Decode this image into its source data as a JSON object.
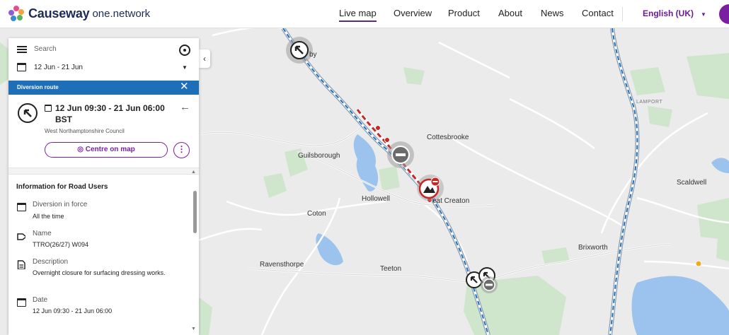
{
  "header": {
    "brand": "Causeway",
    "brand_sub": "one.network",
    "nav": [
      "Live map",
      "Overview",
      "Product",
      "About",
      "News",
      "Contact"
    ],
    "active_nav": "Live map",
    "language": "English (UK)"
  },
  "panel": {
    "search_placeholder": "Search",
    "date_range": "12 Jun - 21 Jun",
    "diversion_title": "Diversion route",
    "timeframe": "12 Jun 09:30 - 21 Jun 06:00 BST",
    "council": "West Northamptonshire Council",
    "centre_button": "Centre on map",
    "info_heading": "Information for Road Users",
    "rows": [
      {
        "label": "Diversion in force",
        "value": "All the time",
        "icon": "calendar-sync-icon"
      },
      {
        "label": "Name",
        "value": "TTRO(26/27) W094",
        "icon": "tag-icon"
      },
      {
        "label": "Description",
        "value": "Overnight closure for surfacing dressing works.",
        "icon": "document-icon"
      },
      {
        "label": "Date",
        "value": "12 Jun 09:30 - 21 Jun 06:00",
        "icon": "calendar-icon"
      }
    ]
  },
  "map": {
    "places": [
      "by",
      "Cottesbrooke",
      "Guilsborough",
      "Hollowell",
      "eat Creaton",
      "Coton",
      "Scaldwell",
      "LAMPORT",
      "Brixworth",
      "Ravensthorpe",
      "Teeton"
    ]
  },
  "colors": {
    "brand_purple": "#7b1fa2",
    "diversion_blue": "#1d6fb8",
    "closure_red": "#c62828"
  }
}
